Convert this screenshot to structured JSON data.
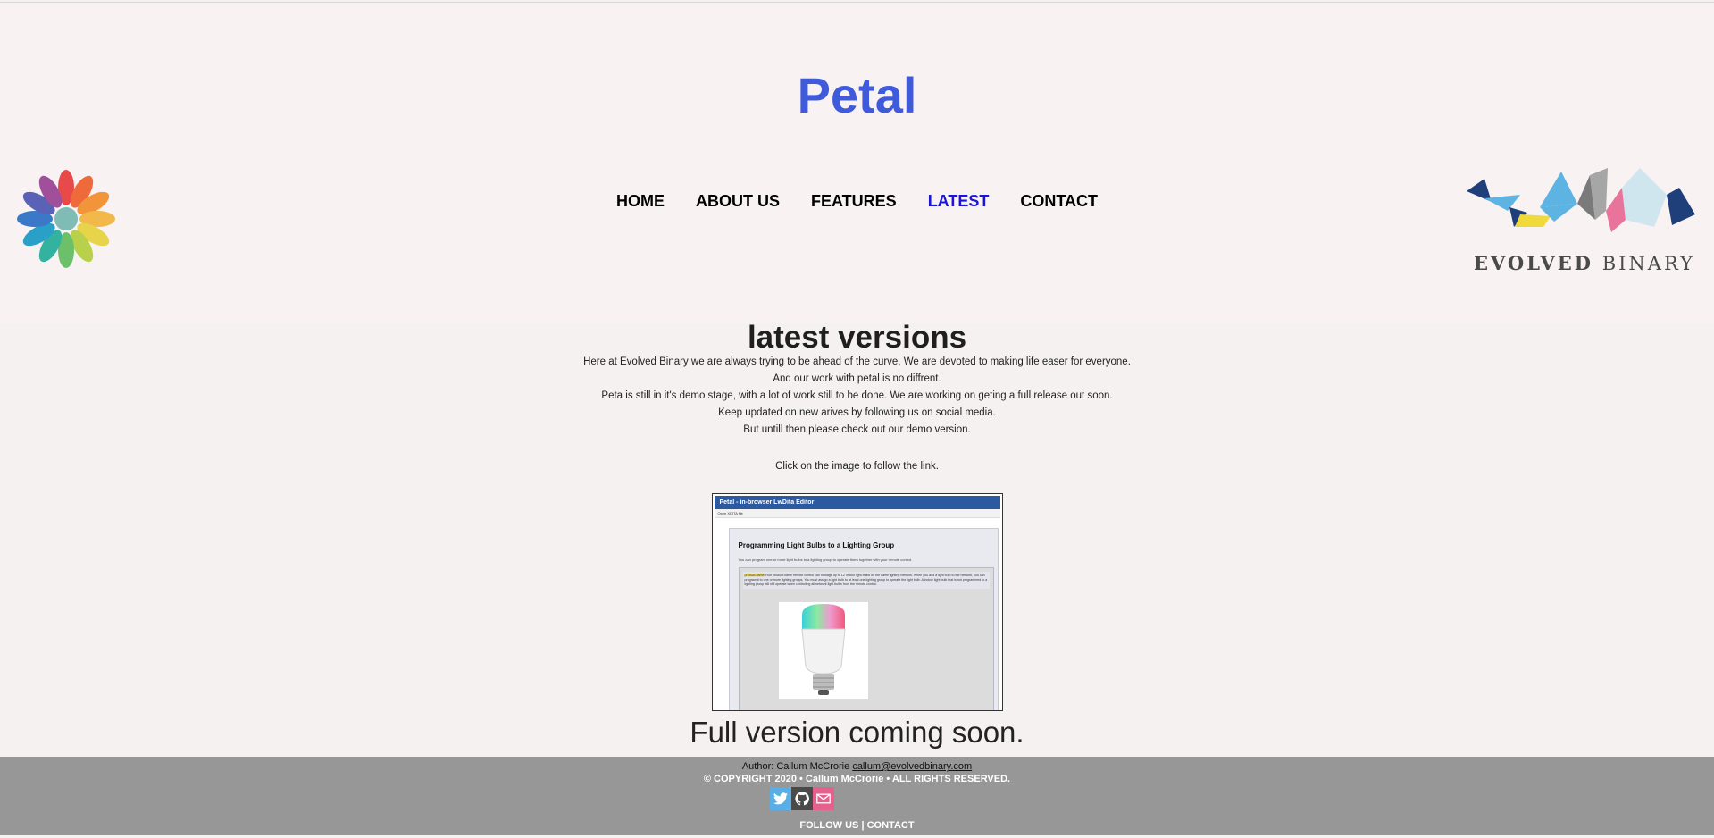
{
  "site": {
    "title": "Petal",
    "brand_color": "#3f5bdc"
  },
  "nav": {
    "items": [
      {
        "label": "HOME"
      },
      {
        "label": "ABOUT US"
      },
      {
        "label": "FEATURES"
      },
      {
        "label": "LATEST"
      },
      {
        "label": "CONTACT"
      }
    ],
    "active": "LATEST",
    "active_color": "#1a14d4"
  },
  "logos": {
    "left": "petal-flower-icon",
    "right_text_1": "EVOLVED",
    "right_text_2": "BINARY"
  },
  "main": {
    "heading": "latest versions",
    "paragraphs": [
      "Here at Evolved Binary we are always trying to be ahead of the curve, We are devoted to making life easer for everyone.",
      "And our work with petal is no diffrent.",
      "Peta is still in it's demo stage, with a lot of work still to be done. We are working on geting a full release out soon.",
      "Keep updated on new arives by following us on social media.",
      "But untill then please check out our demo version."
    ],
    "click_note": "Click on the image to follow the link.",
    "demo_image": {
      "app_title": "Petal - in-browser LwDita Editor",
      "toolbar_file": "Open XDITA file",
      "doc_title": "Programming Light Bulbs to a Lighting Group",
      "doc_short": "You can program one or more light bulbs to a lighting group to operate them together with your remote control.",
      "doc_body": "Your product-name remote control can manage up to 12 Indoor light bulbs on the same lighting network. When you add a light bulb to the network, you can program it to one or more lighting groups. You must assign a light bulb to at least one lighting group to operate the light bulb. A Indoor light bulb that is not programmed to a lighting group will still operate when controlling all network light bulbs from the remote control.",
      "keyword": "product-name"
    },
    "coming_soon": "Full version coming soon."
  },
  "footer": {
    "author_label": "Author: Callum McCrorie",
    "author_email": "callum@evolvedbinary.com",
    "copyright": "© COPYRIGHT 2020 • Callum McCrorie • ALL RIGHTS RESERVED.",
    "social": [
      "twitter-icon",
      "github-icon",
      "mail-icon"
    ],
    "follow_us": "FOLLOW US",
    "separator": "|",
    "contact": "CONTACT",
    "background": "#979797"
  }
}
